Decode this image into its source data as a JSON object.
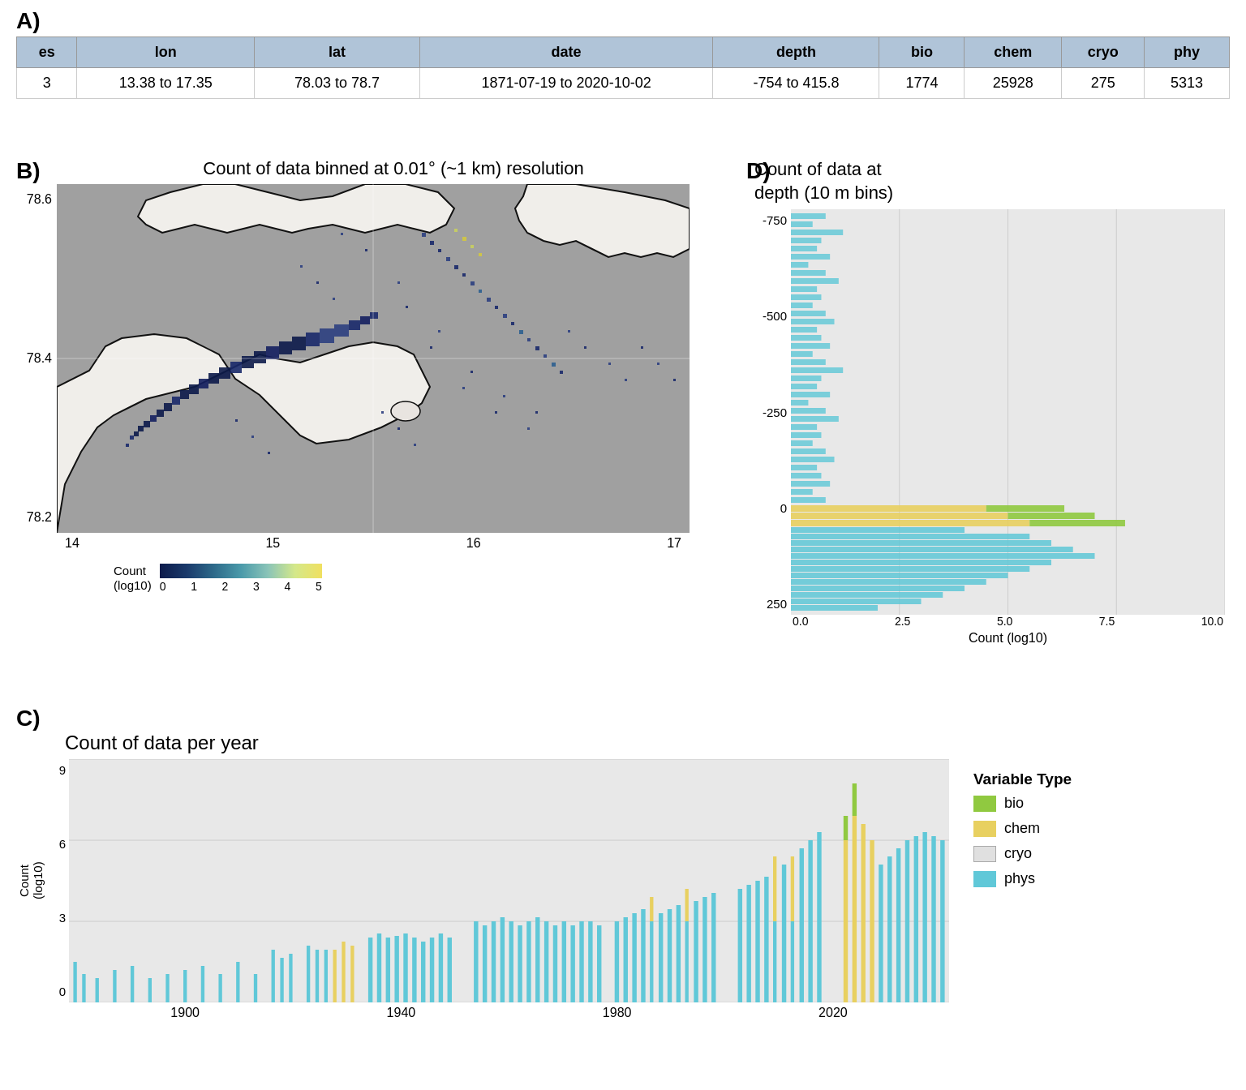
{
  "sectionA": {
    "label": "A)",
    "table": {
      "headers": [
        "es",
        "lon",
        "lat",
        "date",
        "depth",
        "bio",
        "chem",
        "cryo",
        "phy"
      ],
      "rows": [
        [
          "3",
          "13.38 to 17.35",
          "78.03 to 78.7",
          "1871-07-19 to 2020-10-02",
          "-754 to 415.8",
          "1774",
          "25928",
          "275",
          "5313"
        ]
      ]
    }
  },
  "sectionB": {
    "label": "B)",
    "title": "Count of data binned at 0.01° (~1 km) resolution",
    "xLabels": [
      "14",
      "15",
      "16",
      "17"
    ],
    "yLabels": [
      "78.6",
      "78.4",
      "78.2"
    ],
    "legend": {
      "title": "Count\n(log10)",
      "values": [
        "0",
        "1",
        "2",
        "3",
        "4",
        "5"
      ]
    }
  },
  "sectionD": {
    "label": "D)",
    "title": "Count of data at\ndepth (10 m bins)",
    "yLabels": [
      "-750",
      "-500",
      "-250",
      "0",
      "250"
    ],
    "xLabel": "Count (log10)",
    "xLabels": [
      "0.0",
      "2.5",
      "5.0",
      "7.5",
      "10.0"
    ]
  },
  "sectionC": {
    "label": "C)",
    "title": "Count of data per year",
    "yLabel": "Count\n(log10)",
    "yValues": [
      "9",
      "6",
      "3",
      "0"
    ],
    "xLabels": [
      "1900",
      "1940",
      "1980",
      "2020"
    ]
  },
  "legend": {
    "title": "Variable Type",
    "items": [
      {
        "label": "bio",
        "color": "#90c940"
      },
      {
        "label": "chem",
        "color": "#e8d060"
      },
      {
        "label": "cryo",
        "color": "#ffffff"
      },
      {
        "label": "phys",
        "color": "#60c8d8"
      }
    ]
  },
  "colors": {
    "bio": "#90c940",
    "chem": "#e8d060",
    "cryo": "#e0e0e0",
    "phys": "#60c8d8",
    "mapDark": "#0d1b4b",
    "mapLight": "#f0e060",
    "tableHeader": "#b0c4d8"
  }
}
